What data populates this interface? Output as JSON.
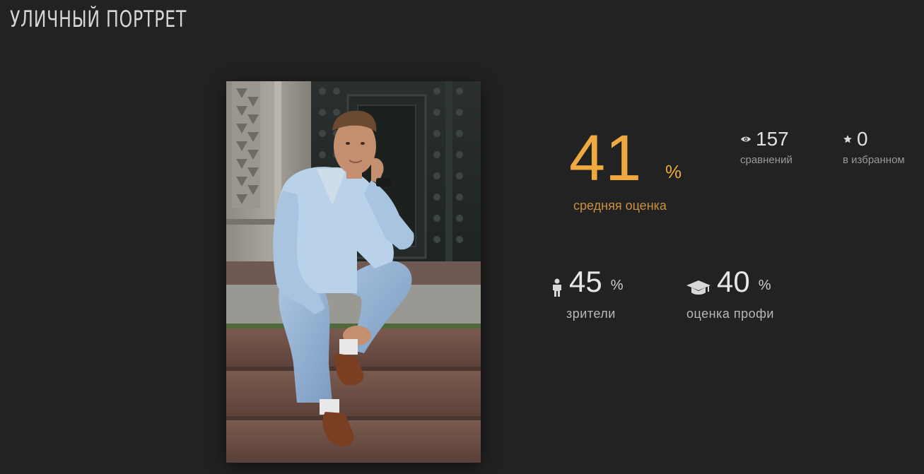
{
  "page": {
    "title": "УЛИЧНЫЙ ПОРТРЕТ"
  },
  "photo": {
    "icon": "portrait-photo"
  },
  "rating": {
    "average_value": "41",
    "average_unit": "%",
    "average_label": "средняя оценка",
    "accent_color": "#f0a840"
  },
  "stats": {
    "views": {
      "icon": "eye-icon",
      "value": "157",
      "label": "сравнений"
    },
    "favorites": {
      "icon": "star-icon",
      "value": "0",
      "label": "в избранном"
    },
    "viewers": {
      "icon": "person-icon",
      "value": "45",
      "unit": "%",
      "label": "зрители"
    },
    "pros": {
      "icon": "graduation-cap-icon",
      "value": "40",
      "unit": "%",
      "label": "оценка профи"
    }
  }
}
